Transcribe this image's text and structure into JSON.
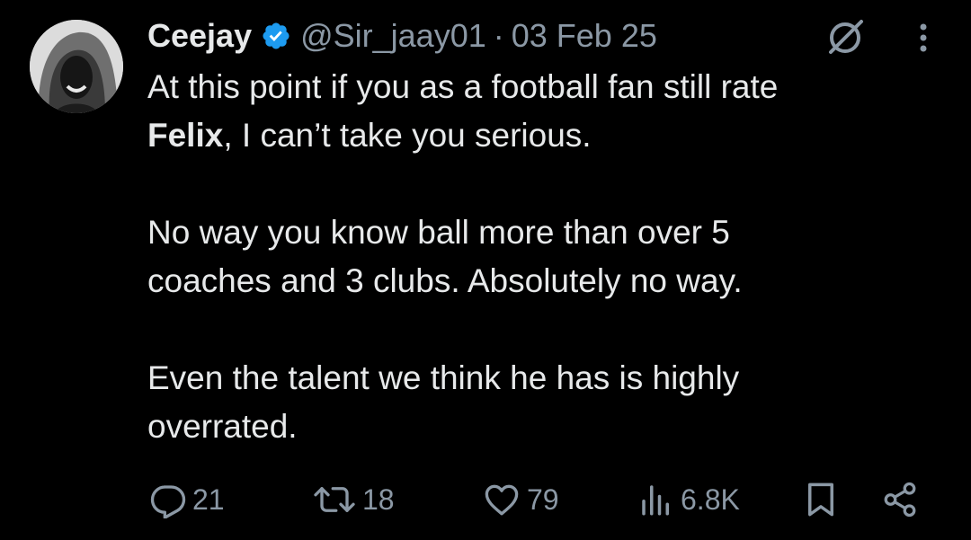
{
  "author": {
    "display_name": "Ceejay",
    "handle": "@Sir_jaay01",
    "separator": "·",
    "date": "03 Feb 25",
    "verified": true
  },
  "tweet": {
    "line1_start": "At this point if you as a football fan still rate",
    "line2_bold": "Felix",
    "line2_rest": ", I can’t take you serious.",
    "paragraph2": "No way you know ball more than over 5 coaches and 3 clubs. Absolutely no way.",
    "paragraph3": "Even the talent we think he has is highly overrated."
  },
  "actions": {
    "replies": "21",
    "retweets": "18",
    "likes": "79",
    "views": "6.8K"
  },
  "icons": {
    "verified": "verified-badge-icon",
    "grok": "grok-icon",
    "more": "more-options-icon",
    "reply": "reply-icon",
    "retweet": "retweet-icon",
    "like": "heart-icon",
    "views": "views-icon",
    "bookmark": "bookmark-icon",
    "share": "share-icon"
  },
  "colors": {
    "background": "#000000",
    "text_primary": "#e7e9ea",
    "text_secondary": "#8b98a5",
    "verified_blue": "#1d9bf0"
  }
}
